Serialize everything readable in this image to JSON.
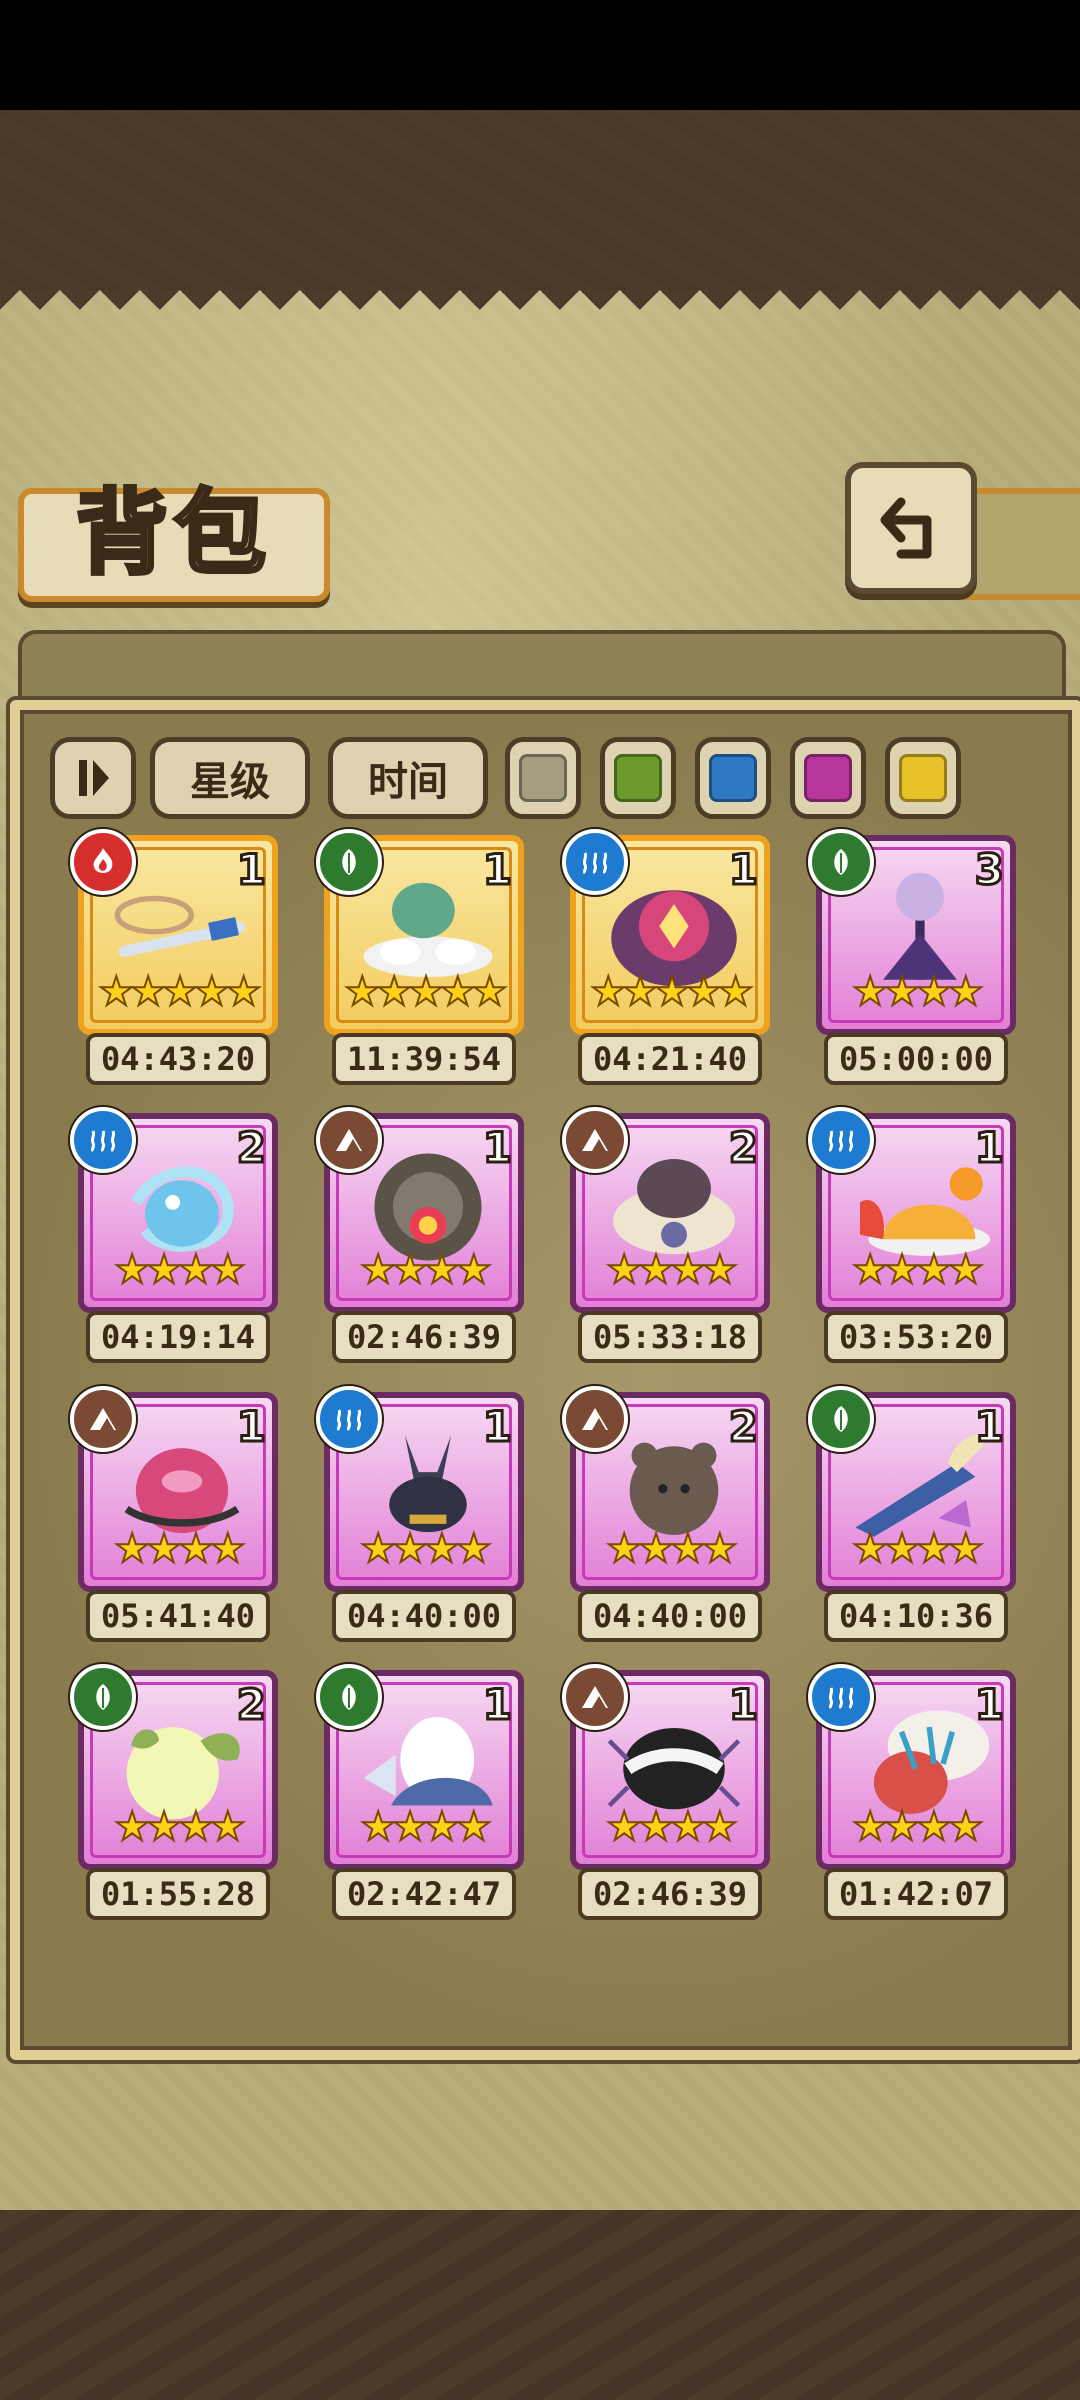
{
  "title": "背包",
  "filters": {
    "star_label": "星级",
    "time_label": "时间"
  },
  "color_filters": [
    "#a59d80",
    "#6c9a2a",
    "#2f78c4",
    "#b8359c",
    "#e7c12a"
  ],
  "items": [
    {
      "count": "1",
      "element": "fire-icon",
      "stars": "★★★★★",
      "timer": "04:43:20",
      "rarity": "gold",
      "art": "sword"
    },
    {
      "count": "1",
      "element": "leaf-icon",
      "stars": "★★★★★",
      "timer": "11:39:54",
      "rarity": "gold",
      "art": "lotus"
    },
    {
      "count": "1",
      "element": "water-icon",
      "stars": "★★★★★",
      "timer": "04:21:40",
      "rarity": "gold",
      "art": "orb"
    },
    {
      "count": "3",
      "element": "leaf-icon",
      "stars": "★★★★",
      "timer": "05:00:00",
      "rarity": "purple",
      "art": "staff"
    },
    {
      "count": "2",
      "element": "water-icon",
      "stars": "★★★★",
      "timer": "04:19:14",
      "rarity": "purple",
      "art": "drop"
    },
    {
      "count": "1",
      "element": "earth-icon",
      "stars": "★★★★",
      "timer": "02:46:39",
      "rarity": "purple",
      "art": "gear"
    },
    {
      "count": "2",
      "element": "earth-icon",
      "stars": "★★★★",
      "timer": "05:33:18",
      "rarity": "purple",
      "art": "bowl"
    },
    {
      "count": "1",
      "element": "water-icon",
      "stars": "★★★★",
      "timer": "03:53:20",
      "rarity": "purple",
      "art": "jelly"
    },
    {
      "count": "1",
      "element": "earth-icon",
      "stars": "★★★★",
      "timer": "05:41:40",
      "rarity": "purple",
      "art": "egg-pink"
    },
    {
      "count": "1",
      "element": "water-icon",
      "stars": "★★★★",
      "timer": "04:40:00",
      "rarity": "purple",
      "art": "jackal"
    },
    {
      "count": "2",
      "element": "earth-icon",
      "stars": "★★★★",
      "timer": "04:40:00",
      "rarity": "purple",
      "art": "bear"
    },
    {
      "count": "1",
      "element": "leaf-icon",
      "stars": "★★★★",
      "timer": "04:10:36",
      "rarity": "purple",
      "art": "blade"
    },
    {
      "count": "2",
      "element": "leaf-icon",
      "stars": "★★★★",
      "timer": "01:55:28",
      "rarity": "purple",
      "art": "fruit"
    },
    {
      "count": "1",
      "element": "leaf-icon",
      "stars": "★★★★",
      "timer": "02:42:47",
      "rarity": "purple",
      "art": "egg-white"
    },
    {
      "count": "1",
      "element": "earth-icon",
      "stars": "★★★★",
      "timer": "02:46:39",
      "rarity": "purple",
      "art": "beetle"
    },
    {
      "count": "1",
      "element": "water-icon",
      "stars": "★★★★",
      "timer": "01:42:07",
      "rarity": "purple",
      "art": "creature"
    }
  ]
}
